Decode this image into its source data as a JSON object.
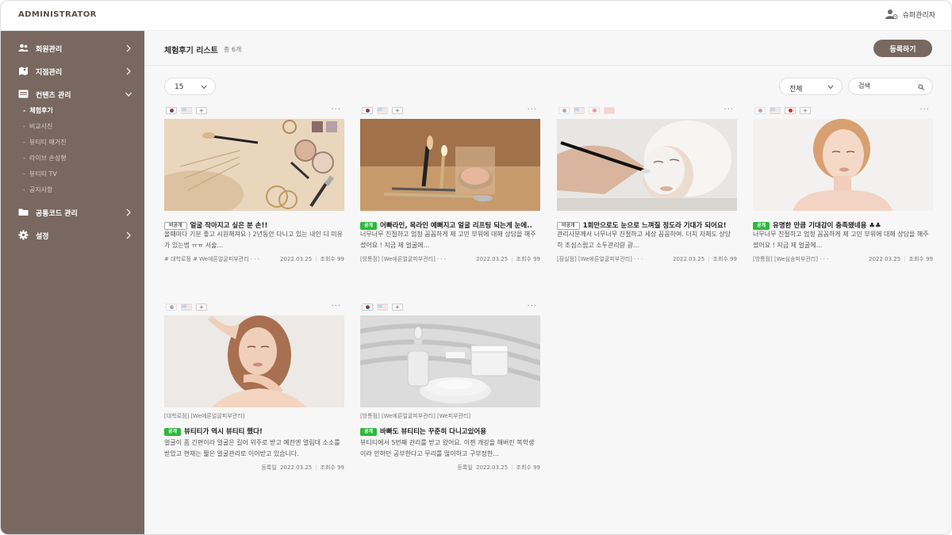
{
  "header": {
    "brand": "ADMINISTRATOR",
    "user_label": "슈퍼관리자"
  },
  "sidebar": {
    "items": [
      {
        "label": "회원관리",
        "icon": "users-icon"
      },
      {
        "label": "지점관리",
        "icon": "map-icon"
      },
      {
        "label": "컨텐츠 관리",
        "icon": "content-icon"
      },
      {
        "label": "공통코드 관리",
        "icon": "folder-icon"
      },
      {
        "label": "설정",
        "icon": "gear-icon"
      }
    ],
    "sub_items": [
      {
        "label": "체험후기",
        "active": true
      },
      {
        "label": "비교사진"
      },
      {
        "label": "뷰티티 매거진"
      },
      {
        "label": "라이브 손성형"
      },
      {
        "label": "뷰티티 TV"
      },
      {
        "label": "공지사항"
      }
    ]
  },
  "page": {
    "title": "체험후기 리스트",
    "count": "총 6개",
    "register_label": "등록하기"
  },
  "filters": {
    "page_size": "15",
    "category": "전체",
    "search_placeholder": "검색"
  },
  "cards": [
    {
      "flags": [
        "kr",
        "us",
        "add"
      ],
      "status": "비공개",
      "title": "얼굴 작아지고 싶은 분 손!!",
      "body": "올때마다 기분 좋고 시원해져요 ) 2년동안 다니고 있는 내인 디 미유가 있는법 ㅠㅠ 서술...",
      "tags": "# 대학로점  # We에른얼굴피부관리 · · ·",
      "date": "2022.03.25",
      "views": "조회수  99"
    },
    {
      "flags": [
        "kr",
        "us",
        "add"
      ],
      "status": "공개",
      "title": "어빠라인, 목라인 예뻐지고 얼굴 리프팅 되는게 눈에..",
      "body": "너무너무 친절하고 엄청 꼼꼼하게 제 고민 부위에 대해 상담을 해주셨어요 ! 지금 제 얼굴에...",
      "tags": "[방통점]  [We에른얼굴피부관리]  · · ·",
      "date": "2022.03.25",
      "views": "조회수  99"
    },
    {
      "flags": [
        "kr",
        "us",
        "jp",
        "cn"
      ],
      "status": "비공개",
      "title": "1회만으로도 눈으로 느껴질 정도라 기대가 되어요!",
      "body": "관리사분께서 너무너무 친절하고 세상 꼼꼼하여. 더치 자체도 상당히 조심스럽고 소두관리랑 광...",
      "tags": "[잠실점]  [We에른얼굴피부관리]  · · ·",
      "date": "2022.03.25",
      "views": "조회수  99"
    },
    {
      "flags": [
        "kr",
        "us",
        "jp",
        "add"
      ],
      "status": "공개",
      "title": "유명한 만큼 기대감이 충족됐네용 ♣♣",
      "body": "너무너무 친절하고 엄청 꼼꼼하게 제 고민 부위에 대해 상담을 해주셨어요 ! 지금 제 얼굴에...",
      "tags": "[방통점]  [We심송피부관리]  · · ·",
      "date": "2022.03.25",
      "views": "조회수  99"
    },
    {
      "flags": [
        "kr",
        "us",
        "add"
      ],
      "status": "공개",
      "title": "뷰티티가 역시 뷰티티 했다!",
      "body": "얼굴이 좀 긴편이라 얼굴은 길이 위주로 받고 예전엔 열림대 소소를 받았고 현재는 짧은 얼굴관리로 이어받고 있습니다.",
      "tags": "[대학로점]  [We에른얼굴피부관리]",
      "date": "2022.03.25",
      "views": "조회수  99",
      "reg_label": "등록일"
    },
    {
      "flags": [
        "kr",
        "us",
        "add"
      ],
      "status": "공개",
      "title": "바빠도 뷰티티는 꾸준히 다니고있어용",
      "body": "뷰티티에서 5번째 관리를 받고 왔어요. 이젠 개강을 해버린 복학생이라 안하던 공부한다고 무리를 많이하고 구부정한...",
      "tags": "[방통점]  [We에른얼굴피부관리]  [We피부관리]",
      "date": "2022.03.25",
      "views": "조회수  99",
      "reg_label": "등록일"
    }
  ],
  "colors": {
    "sidebar": "#786860",
    "accent": "#2db83d",
    "brand": "#5a4e46"
  }
}
